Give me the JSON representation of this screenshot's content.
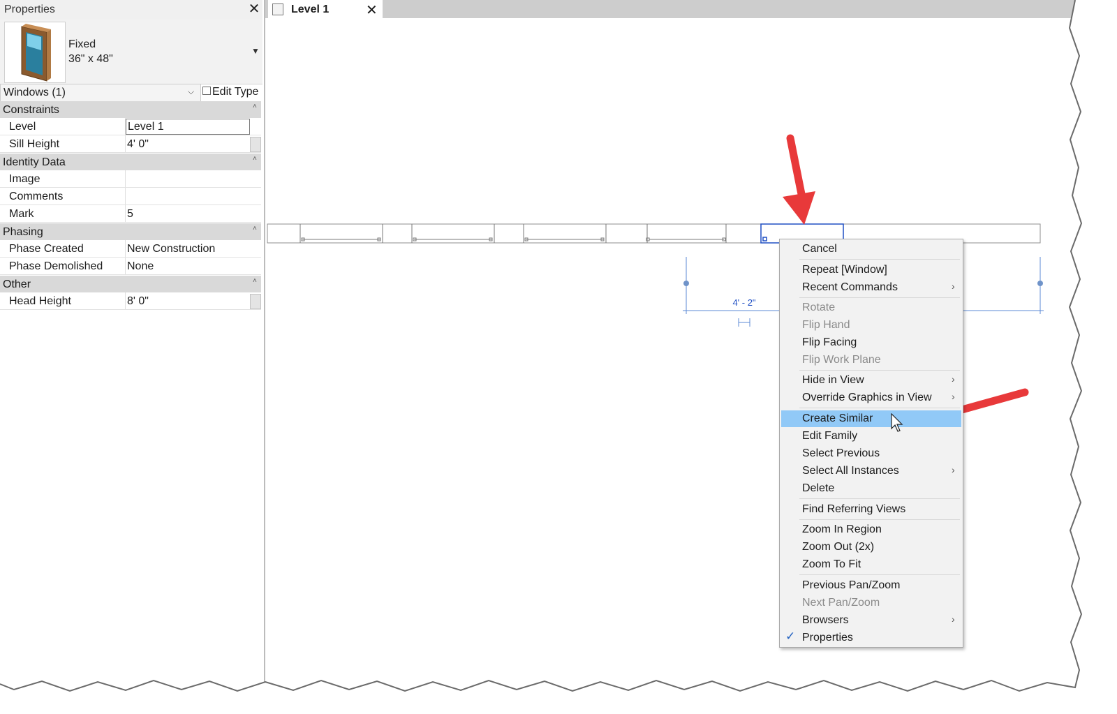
{
  "properties_panel": {
    "title": "Properties",
    "type_name": "Fixed",
    "type_size": "36\" x 48\"",
    "instance_filter": "Windows (1)",
    "edit_type_label": "Edit Type",
    "groups": [
      {
        "name": "Constraints",
        "rows": [
          {
            "label": "Level",
            "value": "Level 1"
          },
          {
            "label": "Sill Height",
            "value": "4'  0\""
          }
        ]
      },
      {
        "name": "Identity Data",
        "rows": [
          {
            "label": "Image",
            "value": ""
          },
          {
            "label": "Comments",
            "value": ""
          },
          {
            "label": "Mark",
            "value": "5"
          }
        ]
      },
      {
        "name": "Phasing",
        "rows": [
          {
            "label": "Phase Created",
            "value": "New Construction"
          },
          {
            "label": "Phase Demolished",
            "value": "None"
          }
        ]
      },
      {
        "name": "Other",
        "rows": [
          {
            "label": "Head Height",
            "value": "8'  0\""
          }
        ]
      }
    ]
  },
  "view_tab": {
    "label": "Level 1"
  },
  "canvas": {
    "dimension_label": "4' - 2\""
  },
  "context_menu": {
    "items": [
      {
        "label": "Cancel"
      },
      {
        "label": "Repeat [Window]"
      },
      {
        "label": "Recent Commands",
        "submenu": true
      },
      {
        "label": "Rotate",
        "disabled": true
      },
      {
        "label": "Flip Hand",
        "disabled": true
      },
      {
        "label": "Flip Facing"
      },
      {
        "label": "Flip Work Plane",
        "disabled": true
      },
      {
        "label": "Hide in View",
        "submenu": true
      },
      {
        "label": "Override Graphics in View",
        "submenu": true
      },
      {
        "label": "Create Similar",
        "highlighted": true
      },
      {
        "label": "Edit Family"
      },
      {
        "label": "Select Previous"
      },
      {
        "label": "Select All Instances",
        "submenu": true
      },
      {
        "label": "Delete"
      },
      {
        "label": "Find Referring Views"
      },
      {
        "label": "Zoom In Region"
      },
      {
        "label": "Zoom Out (2x)"
      },
      {
        "label": "Zoom To Fit"
      },
      {
        "label": "Previous Pan/Zoom"
      },
      {
        "label": "Next Pan/Zoom",
        "disabled": true
      },
      {
        "label": "Browsers",
        "submenu": true
      },
      {
        "label": "Properties",
        "checked": true
      }
    ]
  },
  "colors": {
    "selection": "#1f4fc4",
    "highlight": "#91c9f7",
    "arrow": "#e8393a",
    "panel_group": "#d9d9d9"
  }
}
